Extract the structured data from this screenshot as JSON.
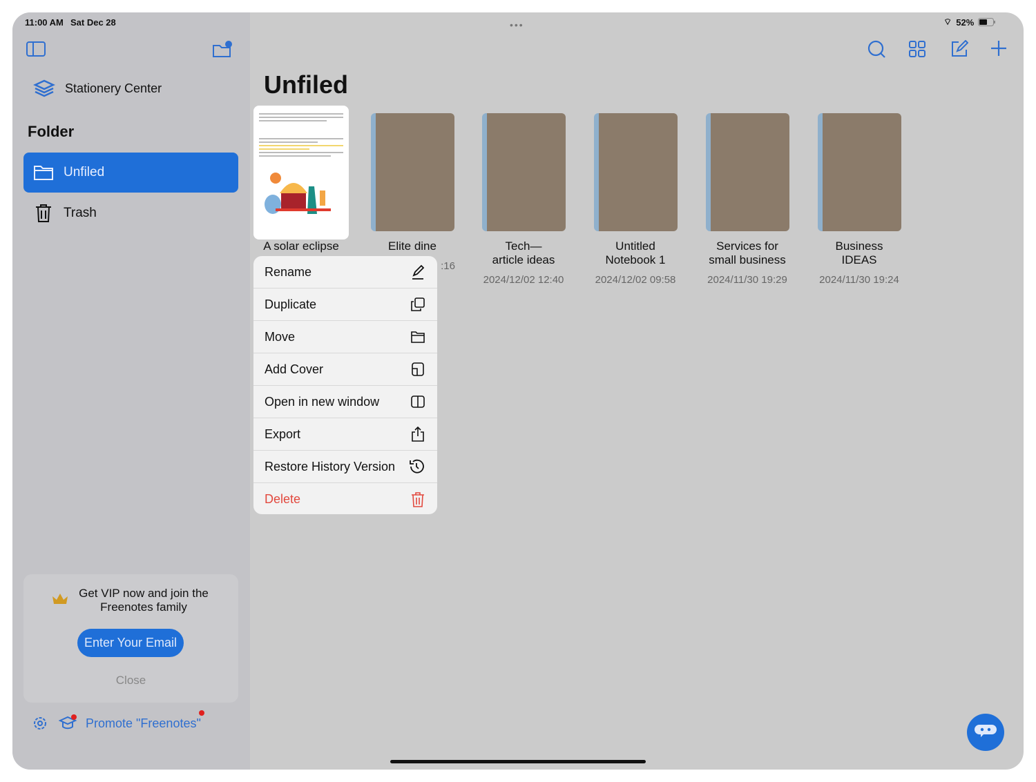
{
  "status": {
    "time": "11:00 AM",
    "date": "Sat Dec 28",
    "battery": "52%"
  },
  "sidebar": {
    "stationery": "Stationery Center",
    "folder_heading": "Folder",
    "items": [
      {
        "label": "Unfiled",
        "active": true
      },
      {
        "label": "Trash"
      }
    ],
    "vip": {
      "text_line1": "Get VIP now and join the",
      "text_line2": "Freenotes family",
      "button": "Enter Your Email",
      "close": "Close"
    },
    "promote": "Promote \"Freenotes\""
  },
  "main": {
    "title": "Unfiled",
    "notebooks": [
      {
        "title": "A solar eclipse",
        "date": ""
      },
      {
        "title": "Elite dine",
        "date": ":16"
      },
      {
        "title": "Tech—",
        "title2": "article ideas",
        "date": "2024/12/02 12:40"
      },
      {
        "title": "Untitled",
        "title2": "Notebook 1",
        "date": "2024/12/02 09:58"
      },
      {
        "title": "Services for",
        "title2": "small business",
        "date": "2024/11/30 19:29"
      },
      {
        "title": "Business IDEAS",
        "date": "2024/11/30 19:24"
      }
    ]
  },
  "menu": [
    {
      "label": "Rename",
      "icon": "pencil-icon"
    },
    {
      "label": "Duplicate",
      "icon": "duplicate-icon"
    },
    {
      "label": "Move",
      "icon": "folder-icon"
    },
    {
      "label": "Add Cover",
      "icon": "cover-icon"
    },
    {
      "label": "Open in new window",
      "icon": "split-window-icon"
    },
    {
      "label": "Export",
      "icon": "share-icon"
    },
    {
      "label": "Restore History Version",
      "icon": "history-icon"
    },
    {
      "label": "Delete",
      "icon": "trash-icon"
    }
  ],
  "colors": {
    "accent": "#1f6fd8",
    "delete": "#e2483d",
    "cover": "#8b7b6a"
  }
}
